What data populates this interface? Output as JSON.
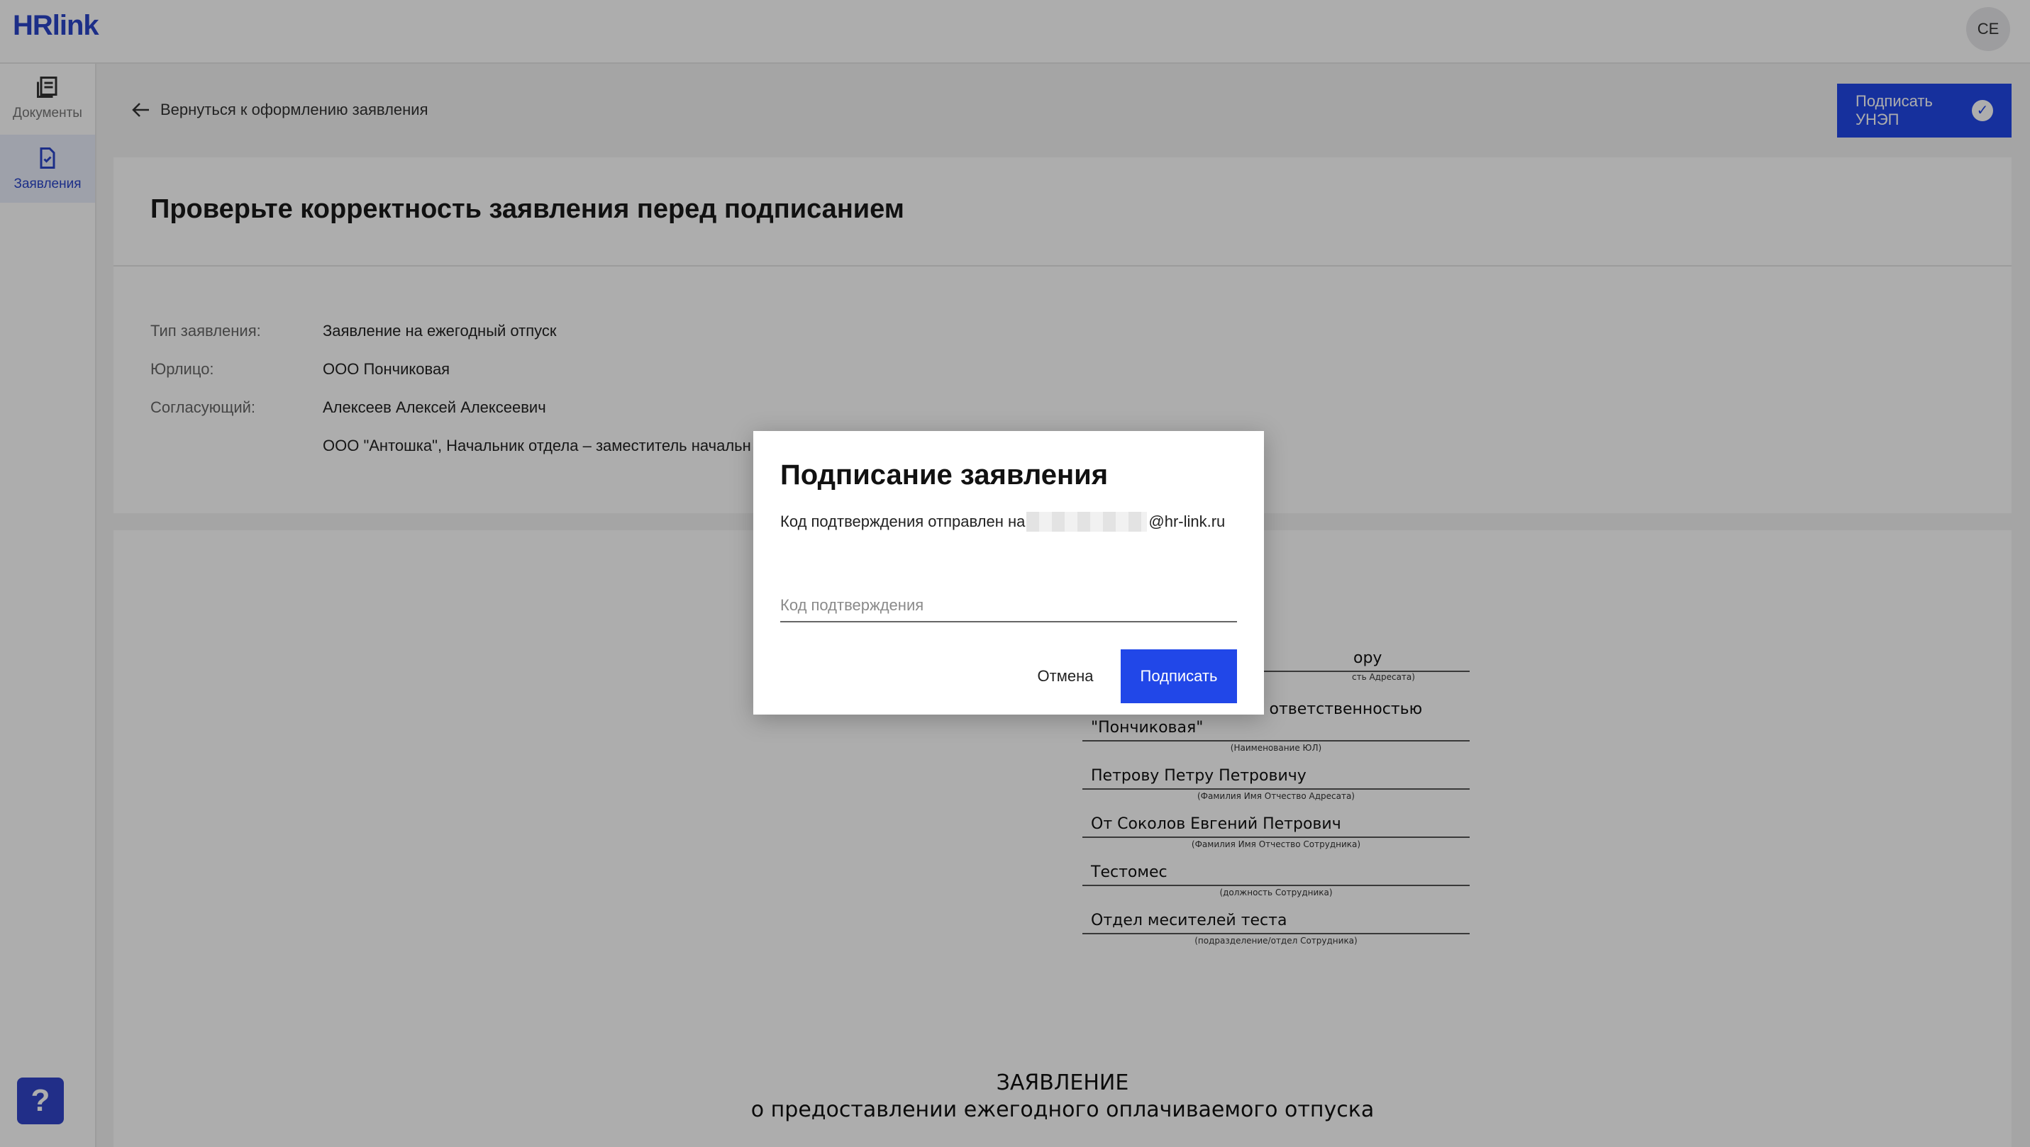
{
  "app": {
    "logo": "HRlink",
    "avatar_initials": "CE"
  },
  "sidebar": {
    "items": [
      {
        "label": "Документы",
        "icon": "documents-icon",
        "active": false
      },
      {
        "label": "Заявления",
        "icon": "application-icon",
        "active": true
      }
    ],
    "help_label": "?"
  },
  "header": {
    "back_label": "Вернуться к оформлению заявления",
    "sign_button_label": "Подписать УНЭП"
  },
  "main": {
    "title": "Проверьте корректность заявления перед подписанием",
    "fields": [
      {
        "label": "Тип заявления:",
        "value": "Заявление на ежегодный отпуск"
      },
      {
        "label": "Юрлицо:",
        "value": "ООО Пончиковая"
      },
      {
        "label": "Согласующий:",
        "value": "Алексеев Алексей Алексеевич"
      },
      {
        "label": "",
        "value": "ООО \"Антошка\", Начальник отдела – заместитель начальн"
      }
    ]
  },
  "document": {
    "lines": [
      {
        "text": "ору",
        "hint": "сть Адресата)"
      },
      {
        "text": "\"Пончиковая\"",
        "hint": "(Наименование ЮЛ)",
        "upper": "нной ответственностью"
      },
      {
        "text": "Петрову Петру Петровичу",
        "hint": "(Фамилия Имя Отчество Адресата)"
      },
      {
        "text": "От Соколов Евгений Петрович",
        "hint": "(Фамилия Имя Отчество Сотрудника)"
      },
      {
        "text": "Тестомес",
        "hint": "(должность Сотрудника)"
      },
      {
        "text": "Отдел месителей теста",
        "hint": "(подразделение/отдел Сотрудника)"
      }
    ],
    "heading": "ЗАЯВЛЕНИЕ",
    "subheading": "о предоставлении ежегодного оплачиваемого отпуска"
  },
  "modal": {
    "title": "Подписание заявления",
    "text_prefix": "Код подтверждения отправлен на",
    "email_suffix": "@hr-link.ru",
    "input_placeholder": "Код подтверждения",
    "input_value": "",
    "cancel_label": "Отмена",
    "confirm_label": "Подписать"
  },
  "colors": {
    "accent": "#2147e8",
    "brand": "#2a45c9"
  }
}
